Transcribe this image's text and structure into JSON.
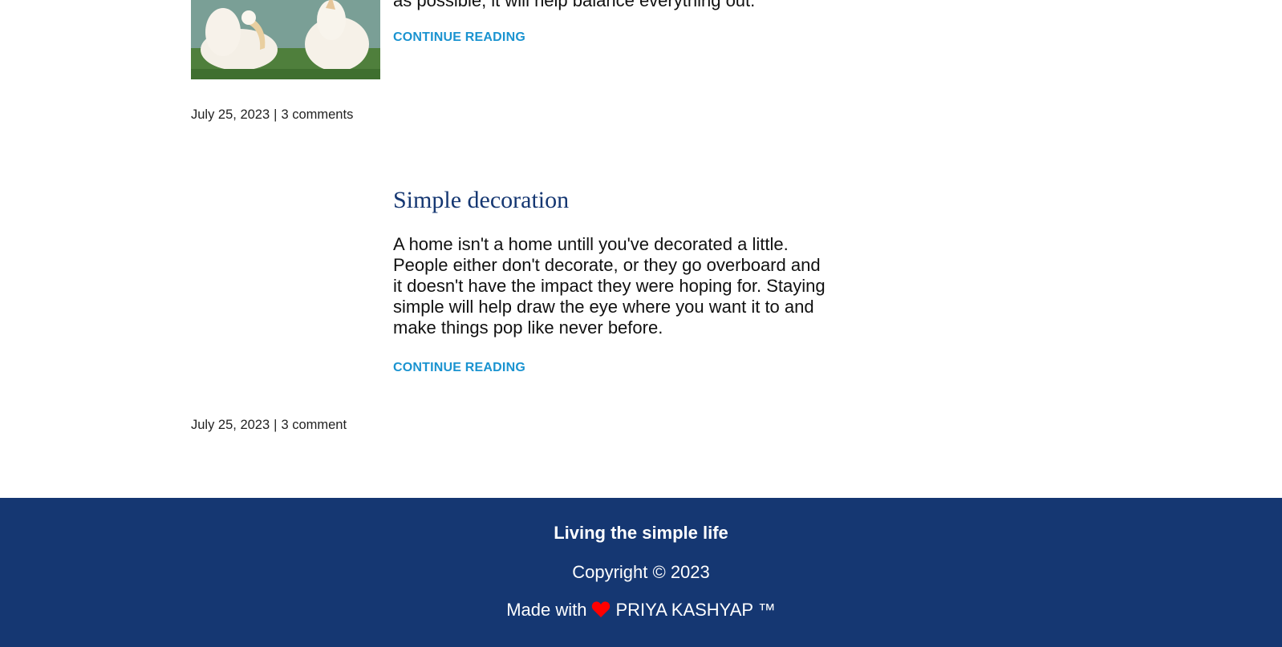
{
  "posts": [
    {
      "image_alt": "Two white pelicans on grass by a pond",
      "excerpt_visible_tail": "as possible, it will help balance everything out.",
      "continue_label": "CONTINUE READING",
      "date": "July 25, 2023",
      "separator": "|",
      "comments": "3 comments"
    },
    {
      "title": "Simple decoration",
      "excerpt": "A home isn't a home untill you've decorated a little. People either don't decorate, or they go overboard and it doesn't have the impact they were hoping for. Staying simple will help draw the eye where you want it to and make things pop like never before.",
      "continue_label": "CONTINUE READING",
      "date": "July 25, 2023",
      "separator": "|",
      "comments": "3 comment"
    }
  ],
  "footer": {
    "tagline": "Living the simple life",
    "copyright": "Copyright © 2023",
    "made_with_prefix": "Made with",
    "author": "PRIYA KASHYAP ™"
  },
  "icons": {
    "heart": "heart-icon"
  },
  "colors": {
    "accent_link": "#1a93d0",
    "title": "#153772",
    "footer_bg": "#153772",
    "heart": "#ff0000"
  }
}
